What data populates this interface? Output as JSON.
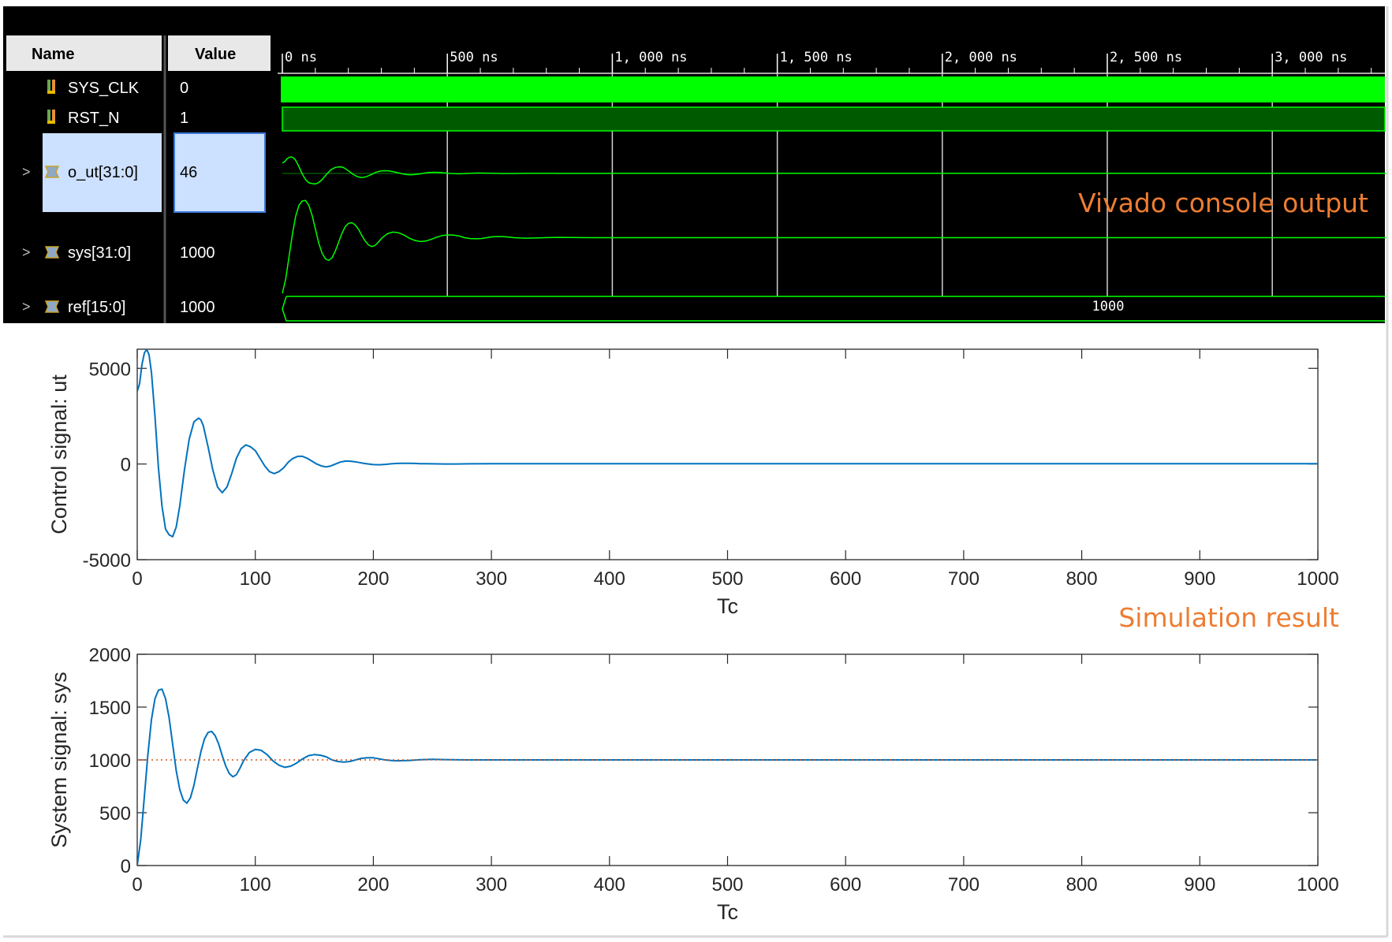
{
  "waveform": {
    "headers": {
      "name": "Name",
      "value": "Value"
    },
    "signals": [
      {
        "expander": "",
        "icon": "wire-icon",
        "name": "SYS_CLK",
        "value": "0",
        "selected": false
      },
      {
        "expander": "",
        "icon": "wire-icon",
        "name": "RST_N",
        "value": "1",
        "selected": false
      },
      {
        "expander": ">",
        "icon": "bus-icon",
        "name": "o_ut[31:0]",
        "value": "46",
        "selected": true
      },
      {
        "expander": ">",
        "icon": "bus-icon",
        "name": "sys[31:0]",
        "value": "1000",
        "selected": false
      },
      {
        "expander": ">",
        "icon": "bus-icon",
        "name": "ref[15:0]",
        "value": "1000",
        "selected": false
      }
    ],
    "time_ticks": [
      "0 ns",
      "500 ns",
      "1, 000 ns",
      "1, 500 ns",
      "2, 000 ns",
      "2, 500 ns",
      "3, 000 ns"
    ],
    "ref_bus_label": "1000",
    "colors": {
      "wave": "#00ff00",
      "rst_fill": "#005a00",
      "grid": "#d0d0d0",
      "selected": "#cce0ff"
    }
  },
  "annotations": {
    "vivado": "Vivado console output",
    "simulation": "Simulation result",
    "color": "#ed7d31"
  },
  "chart_data": [
    {
      "type": "line",
      "title": "",
      "xlabel": "Tc",
      "ylabel": "Control signal: ut",
      "xlim": [
        0,
        1000
      ],
      "ylim": [
        -5000,
        6000
      ],
      "xticks": [
        0,
        100,
        200,
        300,
        400,
        500,
        600,
        700,
        800,
        900,
        1000
      ],
      "yticks": [
        -5000,
        0,
        5000
      ],
      "ytick_labels": [
        "-5000",
        "0",
        "5000"
      ],
      "grid": false,
      "series": [
        {
          "color": "#0072bd",
          "style": "solid",
          "x": [
            0,
            2,
            4,
            6,
            8,
            10,
            12,
            15,
            18,
            21,
            24,
            27,
            30,
            33,
            36,
            40,
            44,
            48,
            52,
            54,
            56,
            60,
            64,
            68,
            72,
            76,
            80,
            84,
            88,
            92,
            96,
            100,
            104,
            108,
            112,
            116,
            120,
            124,
            128,
            132,
            136,
            140,
            144,
            148,
            152,
            156,
            160,
            164,
            168,
            172,
            176,
            180,
            184,
            188,
            192,
            196,
            200,
            205,
            210,
            215,
            220,
            225,
            230,
            235,
            240,
            245,
            250,
            255,
            260,
            270,
            280,
            300,
            350,
            400,
            500,
            600,
            700,
            800,
            900,
            1000
          ],
          "y": [
            3800,
            4200,
            5200,
            5800,
            6000,
            5700,
            4800,
            2500,
            -200,
            -2200,
            -3400,
            -3700,
            -3800,
            -3300,
            -2200,
            -300,
            1300,
            2200,
            2400,
            2300,
            2000,
            900,
            -300,
            -1200,
            -1500,
            -1200,
            -500,
            300,
            800,
            1000,
            900,
            700,
            300,
            -100,
            -400,
            -500,
            -400,
            -200,
            100,
            300,
            400,
            400,
            300,
            150,
            0,
            -100,
            -150,
            -100,
            0,
            100,
            150,
            150,
            120,
            80,
            30,
            0,
            -30,
            -40,
            -20,
            10,
            30,
            40,
            40,
            30,
            20,
            15,
            10,
            5,
            0,
            0,
            10,
            20,
            20,
            20,
            20,
            20,
            20,
            20,
            20,
            20
          ]
        }
      ]
    },
    {
      "type": "line",
      "title": "",
      "xlabel": "Tc",
      "ylabel": "System signal: sys",
      "xlim": [
        0,
        1000
      ],
      "ylim": [
        0,
        2000
      ],
      "xticks": [
        0,
        100,
        200,
        300,
        400,
        500,
        600,
        700,
        800,
        900,
        1000
      ],
      "yticks": [
        0,
        500,
        1000,
        1500,
        2000
      ],
      "ytick_labels": [
        "0",
        "500",
        "1000",
        "1500",
        "2000"
      ],
      "grid": false,
      "series": [
        {
          "color": "#0072bd",
          "style": "solid",
          "x": [
            0,
            3,
            6,
            9,
            12,
            15,
            18,
            21,
            24,
            27,
            30,
            33,
            36,
            39,
            42,
            45,
            48,
            51,
            54,
            57,
            60,
            63,
            66,
            69,
            72,
            75,
            78,
            81,
            84,
            87,
            90,
            95,
            100,
            105,
            110,
            115,
            120,
            125,
            130,
            135,
            140,
            145,
            150,
            155,
            160,
            165,
            170,
            175,
            180,
            185,
            190,
            195,
            200,
            205,
            210,
            215,
            220,
            230,
            240,
            250,
            260,
            280,
            300,
            400,
            600,
            800,
            1000
          ],
          "y": [
            0,
            250,
            650,
            1050,
            1380,
            1580,
            1660,
            1670,
            1580,
            1400,
            1150,
            900,
            720,
            620,
            590,
            640,
            760,
            920,
            1080,
            1200,
            1260,
            1270,
            1230,
            1150,
            1040,
            940,
            870,
            840,
            860,
            920,
            990,
            1070,
            1100,
            1090,
            1050,
            990,
            950,
            930,
            940,
            970,
            1010,
            1040,
            1050,
            1045,
            1030,
            1000,
            985,
            980,
            985,
            1000,
            1015,
            1020,
            1020,
            1010,
            1000,
            995,
            992,
            995,
            1002,
            1005,
            1003,
            1000,
            1000,
            1000,
            1000,
            1000,
            1000
          ]
        },
        {
          "color": "#d95319",
          "style": "dotted",
          "x": [
            0,
            1000
          ],
          "y": [
            1000,
            1000
          ]
        }
      ]
    }
  ]
}
